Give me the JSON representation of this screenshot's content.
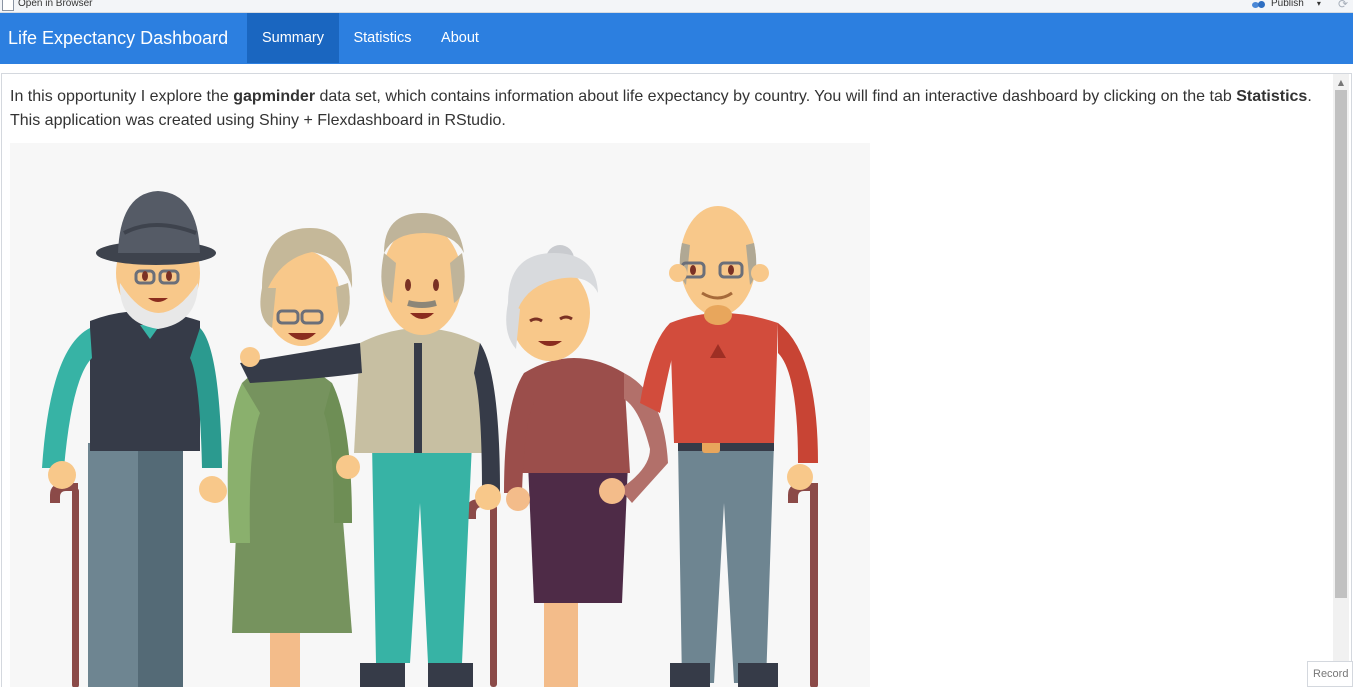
{
  "viewer_toolbar": {
    "open_in_browser_label": "Open in Browser",
    "publish_label": "Publish",
    "publish_caret": "▾",
    "refresh_icon": "⟳"
  },
  "navbar": {
    "brand": "Life Expectancy Dashboard",
    "tabs": [
      {
        "label": "Summary",
        "active": true
      },
      {
        "label": "Statistics",
        "active": false
      },
      {
        "label": "About",
        "active": false
      }
    ],
    "color": "#2c7fe0",
    "active_color": "#1a66c0"
  },
  "intro": {
    "text_1": "In this opportunity I explore the ",
    "bold_1": "gapminder",
    "text_2": " data set, which contains information about life expectancy by country. You will find an interactive dashboard by clicking on the tab ",
    "bold_2": "Statistics",
    "text_3": ". This application was created using Shiny + Flexdashboard in RStudio."
  },
  "illustration": {
    "icon": "elderly-people-illustration"
  },
  "record_button": {
    "label": "Record"
  }
}
